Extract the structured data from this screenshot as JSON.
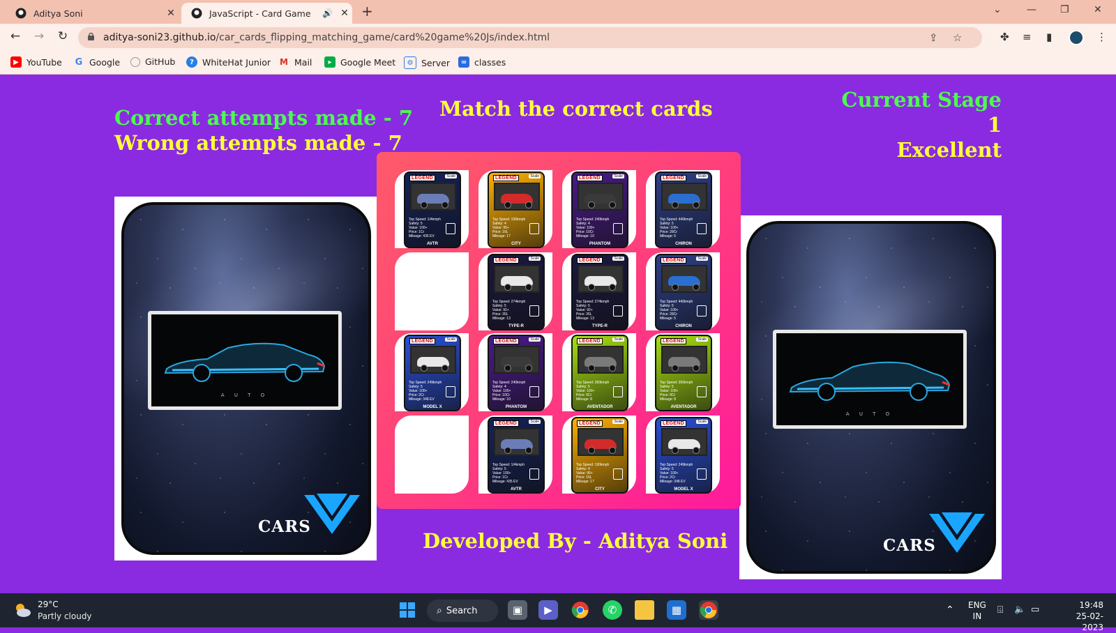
{
  "browser": {
    "tabs": [
      {
        "title": "Aditya Soni",
        "active": false
      },
      {
        "title": "JavaScript - Card Game",
        "active": true
      }
    ],
    "url_host": "aditya-soni23.github.io",
    "url_path": "/car_cards_flipping_matching_game/card%20game%20Js/index.html",
    "bookmarks": [
      "YouTube",
      "Google",
      "GitHub",
      "WhiteHat Junior",
      "Mail",
      "Google Meet",
      "Server",
      "classes"
    ]
  },
  "game": {
    "correct_text": "Correct attempts made - 7",
    "wrong_text": "Wrong attempts made - 7",
    "heading": "Match the correct cards",
    "stage_label": "Current Stage",
    "stage_number": "1",
    "rating": "Excellent",
    "credit": "Developed By - Aditya Soni",
    "back_card_brand": "CARS",
    "back_card_caption": "A U T O",
    "legend_label": "LEGEND",
    "scale_label": "Scale",
    "grid": [
      [
        "AVTR",
        "CITY",
        "PHANTOM",
        "CHIRON"
      ],
      [
        "",
        "TYPE-R",
        "TYPE-R",
        "CHIRON"
      ],
      [
        "MODEL X",
        "PHANTOM",
        "AVENTADOR",
        "AVENTADOR"
      ],
      [
        "",
        "AVTR",
        "CITY",
        "MODEL X"
      ]
    ],
    "card_stats": {
      "AVTR": [
        "Top Speed: 1/4kmph",
        "Safety: 5",
        "Value: 100+",
        "Price: 1Cr",
        "Mileage: 435 EV"
      ],
      "CITY": [
        "Top Speed: 190kmph",
        "Safety: 4",
        "Value: 90+",
        "Price: 16L",
        "Mileage: 17"
      ],
      "PHANTOM": [
        "Top Speed: 240kmph",
        "Safety: 4",
        "Value: 100+",
        "Price: 10Cr",
        "Mileage: 10"
      ],
      "CHIRON": [
        "Top Speed: 440kmph",
        "Safety: 5",
        "Value: 100+",
        "Price: 28Cr",
        "Mileage: 5"
      ],
      "TYPE-R": [
        "Top Speed: 274kmph",
        "Safety: 5",
        "Value: 92+",
        "Price: 35L",
        "Mileage: 13"
      ],
      "MODEL X": [
        "Top Speed: 249kmph",
        "Safety: 5",
        "Value: 100+",
        "Price: 2Cr",
        "Mileage: 348 EV"
      ],
      "AVENTADOR": [
        "Top Speed: 350kmph",
        "Safety: 5",
        "Value: 100+",
        "Price: 9Cr",
        "Mileage: 8"
      ]
    },
    "card_emblems": {
      "AVTR": "mercedes-star-icon",
      "CITY": "honda-logo-icon",
      "PHANTOM": "rolls-royce-logo-icon",
      "CHIRON": "bugatti-logo-icon",
      "TYPE-R": "honda-logo-icon",
      "MODEL X": "tesla-logo-icon",
      "AVENTADOR": "lamborghini-logo-icon"
    },
    "card_themes": {
      "AVTR": {
        "bg": "#14215a",
        "car": "#6a7db8"
      },
      "CITY": {
        "bg": "#ffb000",
        "car": "#d42a2a"
      },
      "PHANTOM": {
        "bg": "#4a1a8a",
        "car": "#3a3a3a"
      },
      "CHIRON": {
        "bg": "#2d3f8a",
        "car": "#2a6fd0"
      },
      "TYPE-R": {
        "bg": "#1a1840",
        "car": "#e8e8e8"
      },
      "MODEL X": {
        "bg": "#2a4fd8",
        "car": "#e8e8e8"
      },
      "AVENTADOR": {
        "bg": "#a8e010",
        "car": "#7a7a7a"
      }
    }
  },
  "colors": {
    "page_bg": "#8a2be2",
    "correct_green": "#4cff4c",
    "accent_yellow": "#ffff3a",
    "board_gradient_start": "#ff5a6a",
    "board_gradient_end": "#ff1a9c"
  },
  "taskbar": {
    "temperature": "29°C",
    "weather": "Partly cloudy",
    "search_label": "Search",
    "lang_top": "ENG",
    "lang_bottom": "IN",
    "time": "19:48",
    "date": "25-02-2023"
  }
}
